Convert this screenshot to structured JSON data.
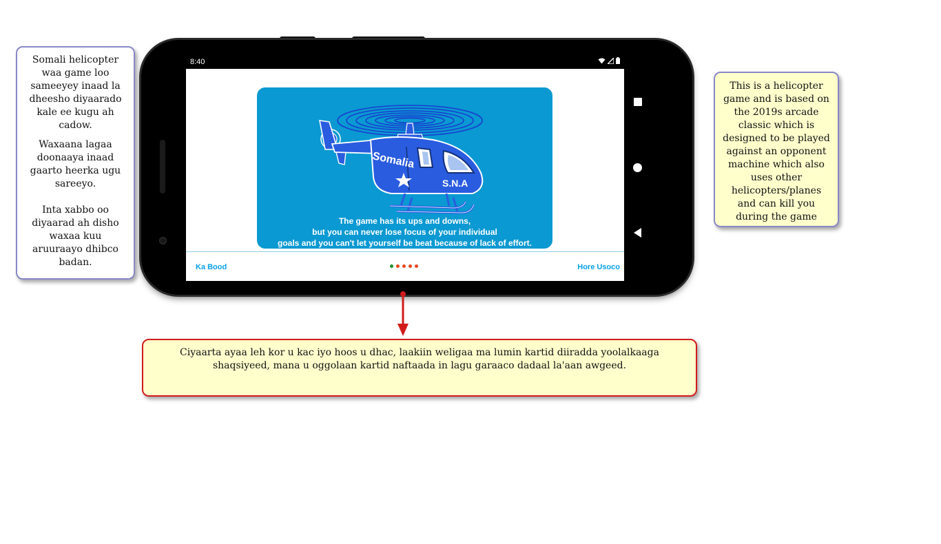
{
  "notes": {
    "left": {
      "p1": "Somali helicopter waa game loo sameeyey inaad la dheesho diyaarado kale ee kugu ah cadow.",
      "p2": "Waxaana lagaa doonaaya inaad gaarto heerka ugu sareeyo.\n\nInta xabbo oo diyaarad ah disho waxaa kuu aruuraayo dhibco badan."
    },
    "right": "This is a helicopter game and is based on the 2019s arcade classic which is designed to be played against an opponent machine which also uses other helicopters/planes and can kill you during the game",
    "bottom": "Ciyaarta ayaa leh kor u kac iyo hoos u dhac, laakiin weligaa ma lumin kartid diiradda yoolalkaaga shaqsiyeed, mana u oggolaan kartid naftaada in lagu garaaco dadaal la'aan awgeed."
  },
  "statusbar": {
    "time": "8:40",
    "icons": [
      "wifi-icon",
      "signal-icon",
      "battery-icon"
    ]
  },
  "slide": {
    "image_label_1": "Somalia",
    "image_label_2": "S.N.A",
    "caption": "The game has its ups and downs,\nbut you can never lose focus of your individual\ngoals and you can't let yourself be beat because of lack of effort."
  },
  "onboarding": {
    "skip_label": "Ka Bood",
    "next_label": "Hore Usoco",
    "page_count": 5,
    "current_page": 1,
    "dot_active_color": "#1e8c2e",
    "dot_inactive_color": "#e8461a"
  },
  "navbar": {
    "icons": [
      "recent-apps-icon",
      "home-icon",
      "back-icon"
    ]
  },
  "colors": {
    "accent": "#0aa0e6",
    "card_bg": "#0a99d2",
    "note_yellow": "#ffffcc",
    "note_border_blue": "#8888c8",
    "note_border_red": "#d11b1b"
  }
}
